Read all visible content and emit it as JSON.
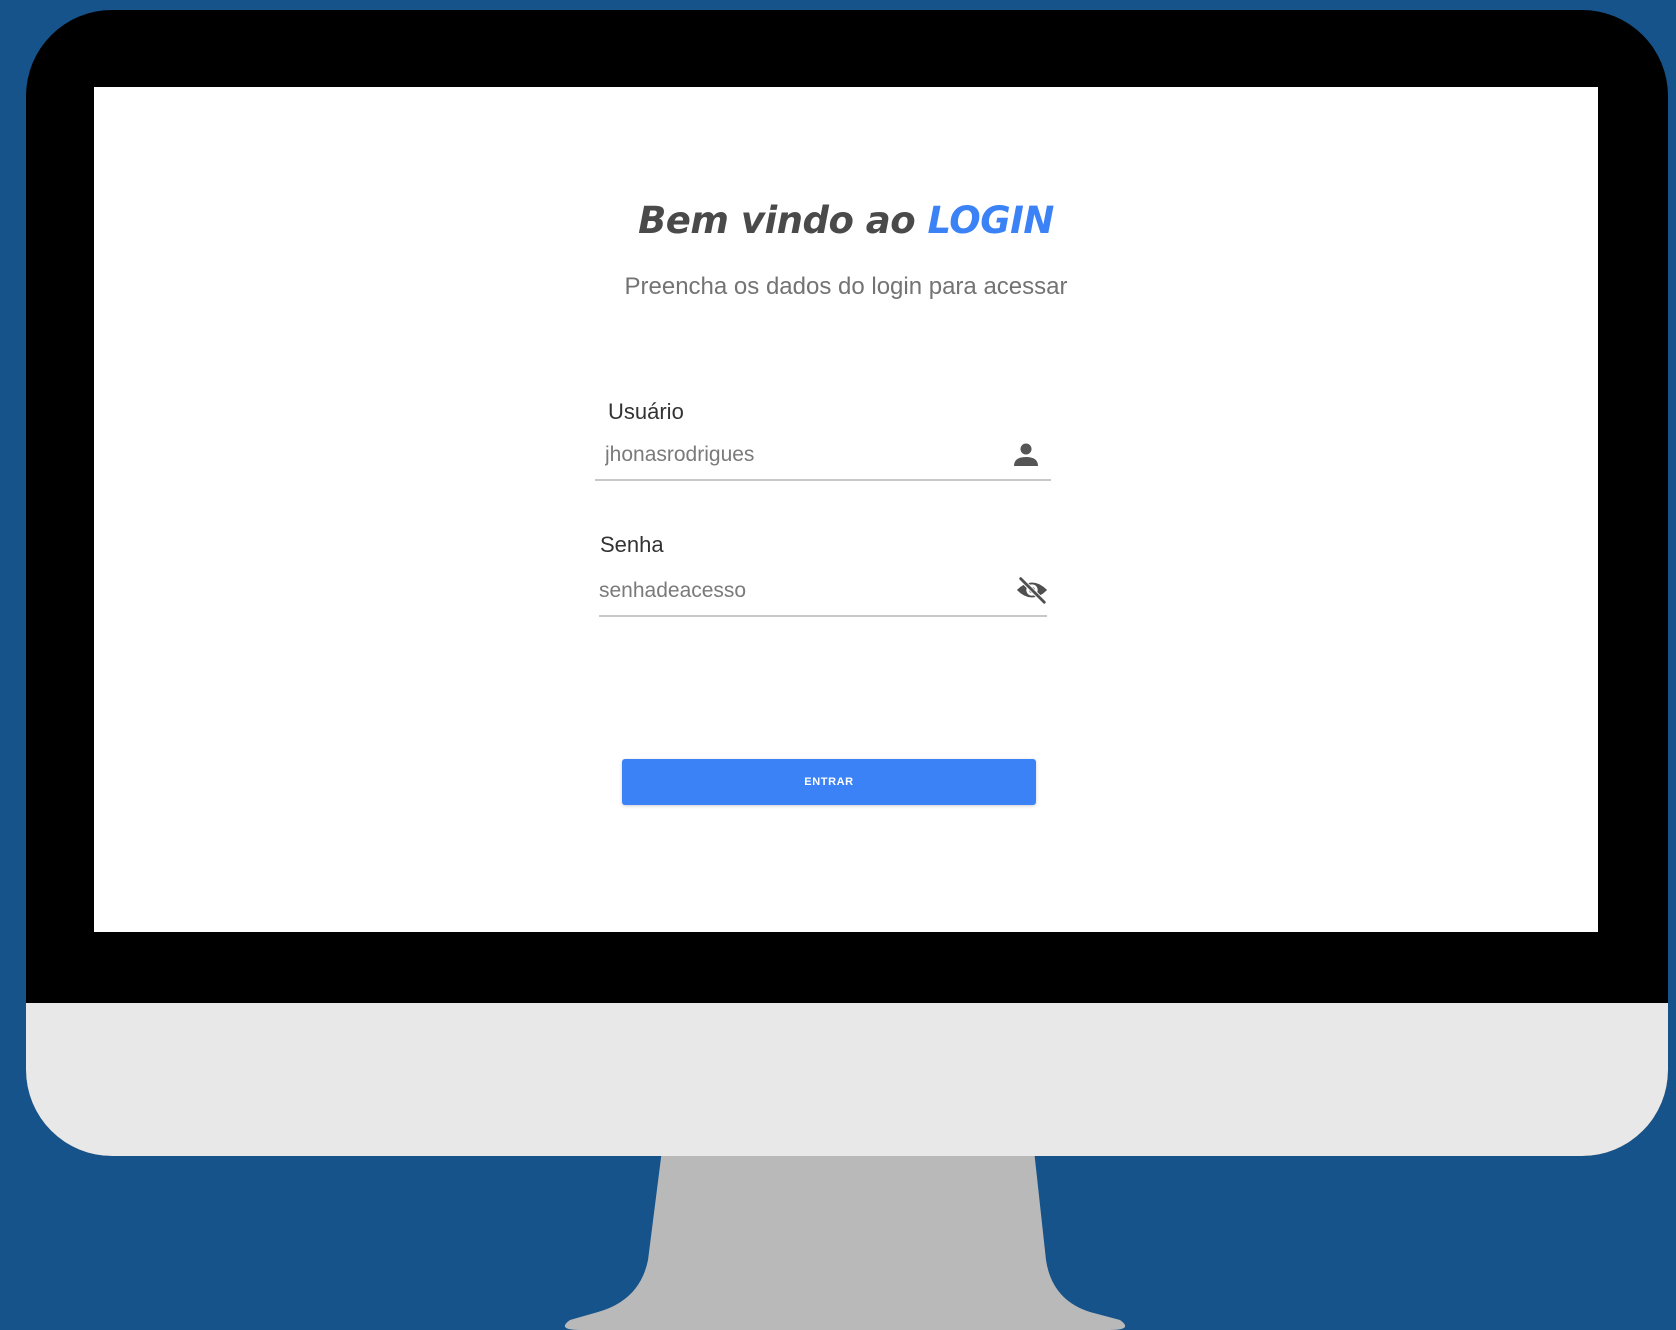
{
  "colors": {
    "background": "#15538a",
    "bezel": "#000000",
    "chin": "#e8e8e9",
    "stand": "#b9b9b9",
    "accent": "#3b82f6",
    "title_text": "#4a4a4a",
    "muted_text": "#737373"
  },
  "login": {
    "title_prefix": "Bem vindo ao ",
    "title_accent": "LOGIN",
    "subtitle": "Preencha os dados do login para acessar",
    "username": {
      "label": "Usuário",
      "value": "jhonasrodrigues",
      "icon": "user-icon"
    },
    "password": {
      "label": "Senha",
      "value": "senhadeacesso",
      "icon": "eye-off-icon"
    },
    "submit_label": "ENTRAR"
  }
}
